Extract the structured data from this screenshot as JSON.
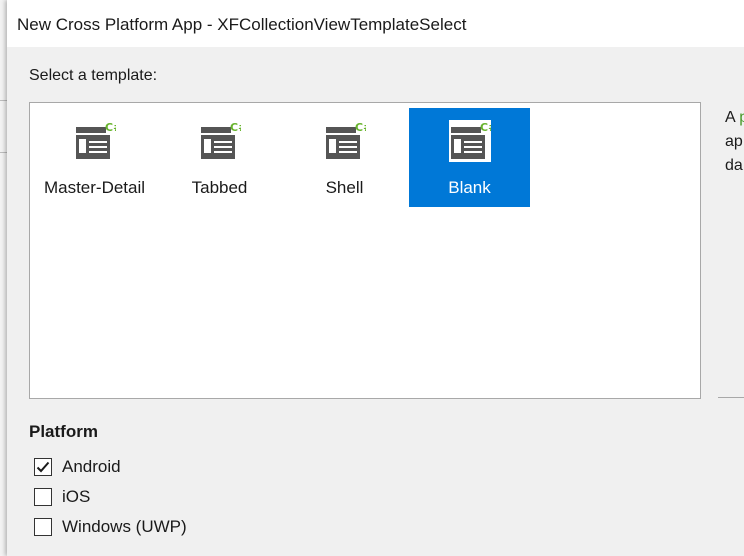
{
  "dialog": {
    "title": "New Cross Platform App - XFCollectionViewTemplateSelect"
  },
  "templates": {
    "label": "Select a template:",
    "items": [
      {
        "label": "Master-Detail",
        "icon": "csharp-template-icon",
        "selected": false
      },
      {
        "label": "Tabbed",
        "icon": "csharp-template-icon",
        "selected": false
      },
      {
        "label": "Shell",
        "icon": "csharp-template-icon",
        "selected": false
      },
      {
        "label": "Blank",
        "icon": "csharp-template-icon",
        "selected": true
      }
    ]
  },
  "description": {
    "line1": "A ",
    "line1_accent": "p",
    "line2": "ap",
    "line3": "da"
  },
  "platform": {
    "heading": "Platform",
    "options": [
      {
        "label": "Android",
        "checked": true
      },
      {
        "label": "iOS",
        "checked": false
      },
      {
        "label": "Windows (UWP)",
        "checked": false
      }
    ]
  },
  "colors": {
    "selection": "#0078d7",
    "csharp_accent": "#68b42e",
    "icon_gray": "#555555"
  }
}
